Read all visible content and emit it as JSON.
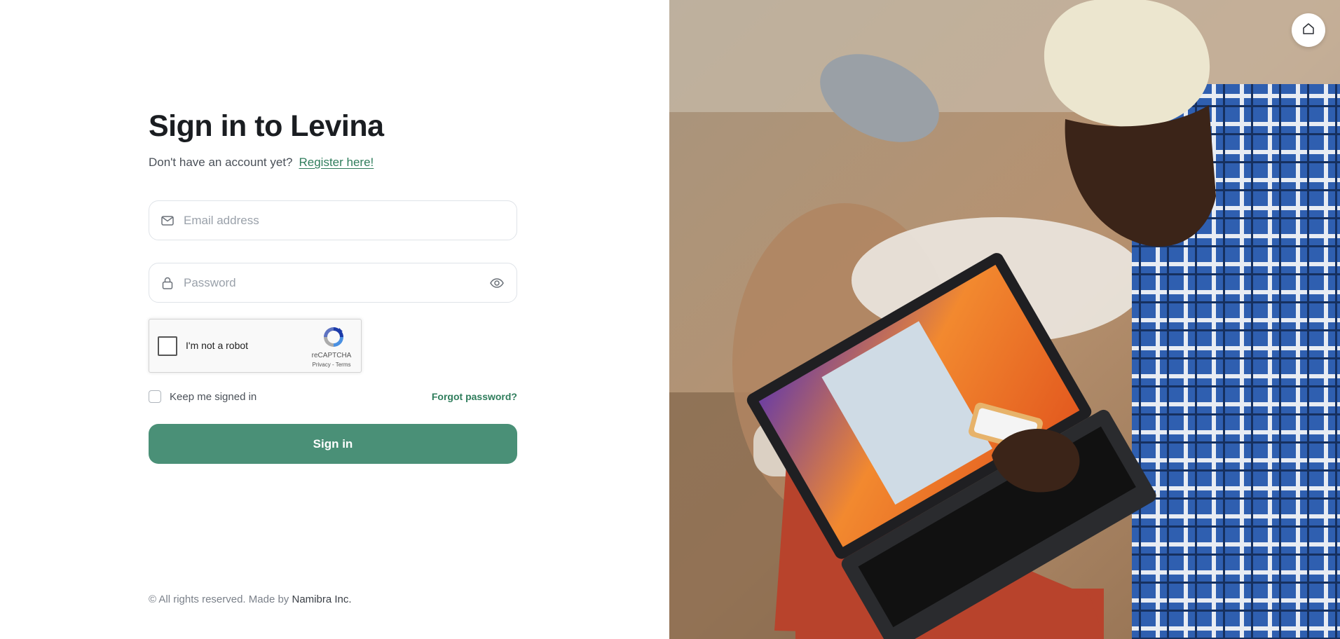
{
  "login": {
    "title": "Sign in to Levina",
    "subtitle_text": "Don't have an account yet?",
    "register_link": "Register here!",
    "email_placeholder": "Email address",
    "password_placeholder": "Password",
    "keep_signed_in": "Keep me signed in",
    "forgot_password": "Forgot password?",
    "submit_label": "Sign in"
  },
  "recaptcha": {
    "label": "I'm not a robot",
    "brand": "reCAPTCHA",
    "links": "Privacy - Terms"
  },
  "footer": {
    "text": "© All rights reserved. Made by",
    "company": "Namibra Inc."
  },
  "icons": {
    "email": "mail-icon",
    "password": "lock-icon",
    "toggle_password": "eye-icon",
    "home": "home-icon"
  },
  "colors": {
    "accent": "#4a9077",
    "link": "#2f7d5c"
  }
}
